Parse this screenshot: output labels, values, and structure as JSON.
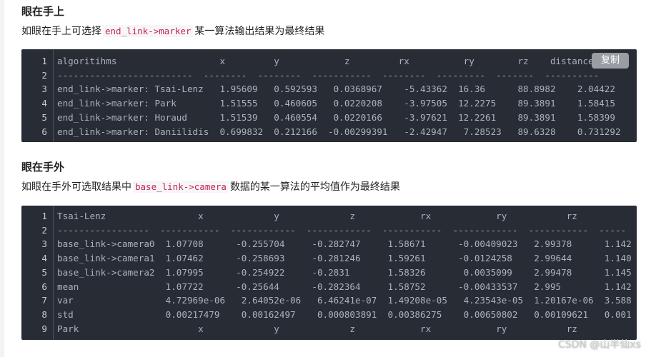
{
  "section1": {
    "heading": "眼在手上",
    "para_before": "如眼在手上可选择",
    "para_code": "end_link->marker",
    "para_after": "某一算法输出结果为最终结果"
  },
  "code1": {
    "copy_label": "复制",
    "lines": [
      {
        "n": "1",
        "text": "algoritihms                   x         y            z         rx          ry        rz    distance"
      },
      {
        "n": "2",
        "text": "-------------------------  --------  --------  -----------  --------  ---------  -------  ----------"
      },
      {
        "n": "3",
        "text": "end_link->marker: Tsai-Lenz   1.95609   0.592593   0.0368967    -5.43362  16.36      88.8982    2.04422"
      },
      {
        "n": "4",
        "text": "end_link->marker: Park        1.51555   0.460605   0.0220208    -3.97505  12.2275    89.3891    1.58415"
      },
      {
        "n": "5",
        "text": "end_link->marker: Horaud      1.51539   0.460554   0.0220166    -3.97621  12.2261    89.3891    1.58399"
      },
      {
        "n": "6",
        "text": "end_link->marker: Daniilidis  0.699832  0.212166  -0.00299391   -2.42947   7.28523   89.6328    0.731292"
      }
    ]
  },
  "section2": {
    "heading": "眼在手外",
    "para_before": "如眼在手外可选取结果中",
    "para_code": "base_link->camera",
    "para_after": "数据的某一算法的平均值作为最终结果"
  },
  "code2": {
    "lines": [
      {
        "n": "1",
        "text": "Tsai-Lenz                 x             y             z            rx            ry           rz"
      },
      {
        "n": "2",
        "text": "-----------------  -----------  ------------  ------------  -----------  ------------  -----------  -----"
      },
      {
        "n": "3",
        "text": "base_link->camera0  1.07708      -0.255704     -0.282747     1.58671      -0.00409023   2.99378      1.142"
      },
      {
        "n": "4",
        "text": "base_link->camera1  1.07462      -0.258693     -0.281246     1.59261      -0.0124258    2.99644      1.140"
      },
      {
        "n": "5",
        "text": "base_link->camera2  1.07995      -0.254922     -0.2831       1.58326       0.0035099    2.99478      1.145"
      },
      {
        "n": "6",
        "text": "mean                1.07722      -0.25644      -0.282364     1.58752      -0.00433537   2.995        1.142"
      },
      {
        "n": "7",
        "text": "var                 4.72969e-06   2.64052e-06   6.46241e-07  1.49208e-05   4.23543e-05  1.20167e-06  3.588"
      },
      {
        "n": "8",
        "text": "std                 0.00217479    0.00162497    0.000803891  0.00386275    0.00650802   0.00109621   0.001"
      },
      {
        "n": "9",
        "text": "Park                      x             y             z            rx            ry           rz"
      }
    ]
  },
  "watermark": "CSDN @山半仙xs"
}
